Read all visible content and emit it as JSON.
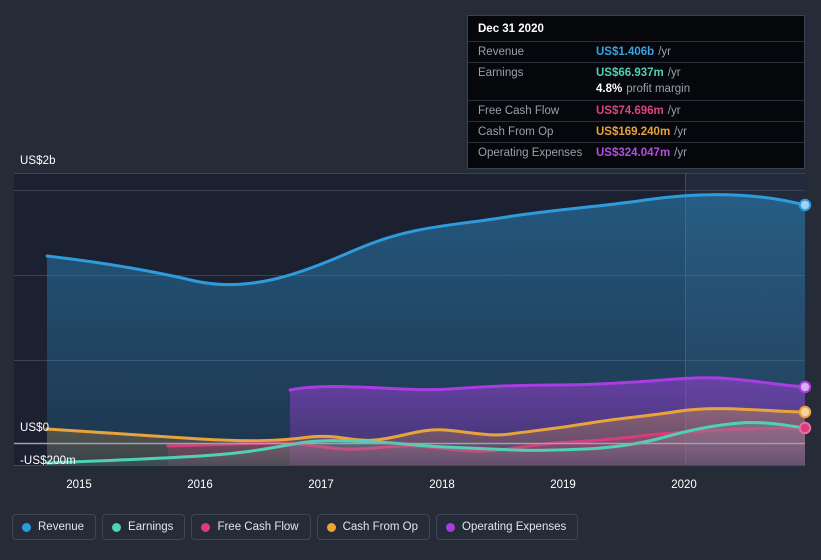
{
  "tooltip": {
    "date": "Dec 31 2020",
    "rows": [
      {
        "label": "Revenue",
        "value": "US$1.406b",
        "unit": "/yr",
        "color": "#3aa3e3"
      },
      {
        "label": "Earnings",
        "value": "US$66.937m",
        "unit": "/yr",
        "color": "#4fd1b3"
      },
      {
        "label": "",
        "value": "4.8%",
        "unit": "profit margin",
        "color": "#ffffff",
        "sub": true
      },
      {
        "label": "Free Cash Flow",
        "value": "US$74.696m",
        "unit": "/yr",
        "color": "#e0437f"
      },
      {
        "label": "Cash From Op",
        "value": "US$169.240m",
        "unit": "/yr",
        "color": "#e8a33d"
      },
      {
        "label": "Operating Expenses",
        "value": "US$324.047m",
        "unit": "/yr",
        "color": "#b44ee0"
      }
    ]
  },
  "legend": {
    "items": [
      {
        "label": "Revenue",
        "color": "#2e9bdd"
      },
      {
        "label": "Earnings",
        "color": "#4fd1b3"
      },
      {
        "label": "Free Cash Flow",
        "color": "#d63d79"
      },
      {
        "label": "Cash From Op",
        "color": "#e8a33d"
      },
      {
        "label": "Operating Expenses",
        "color": "#a83de0"
      }
    ]
  },
  "axes": {
    "y_top_label": "US$2b",
    "y_zero_label": "US$0",
    "y_neg_label": "-US$200m",
    "x_labels": [
      "2015",
      "2016",
      "2017",
      "2018",
      "2019",
      "2020"
    ]
  },
  "chart_data": {
    "type": "area",
    "title": "",
    "subtitle": "",
    "xlabel": "",
    "ylabel": "",
    "grid": true,
    "legend_position": "bottom",
    "xlim": [
      "2014-09",
      "2020-12"
    ],
    "ylim": [
      -200000000,
      2470000000
    ],
    "y_ticks": [
      2000000000,
      0,
      -200000000
    ],
    "y_tick_labels": [
      "US$2b",
      "US$0",
      "-US$200m"
    ],
    "x_ticks": [
      "2015",
      "2016",
      "2017",
      "2018",
      "2019",
      "2020"
    ],
    "units": "USD",
    "highlight_date": "Dec 31 2020",
    "series": [
      {
        "name": "Revenue",
        "color": "#2e9bdd",
        "x": [
          "2014-09",
          "2015-03",
          "2015-09",
          "2016-03",
          "2016-09",
          "2017-03",
          "2017-09",
          "2018-03",
          "2018-09",
          "2019-03",
          "2019-09",
          "2020-03",
          "2020-06",
          "2020-09",
          "2020-12"
        ],
        "values": [
          1100000000,
          1075000000,
          1035000000,
          1030000000,
          1085000000,
          1190000000,
          1255000000,
          1320000000,
          1370000000,
          1430000000,
          1480000000,
          1560000000,
          1555000000,
          1500000000,
          1406000000
        ],
        "last_value": 1406000000,
        "last_value_label": "US$1.406b"
      },
      {
        "name": "Earnings",
        "color": "#4fd1b3",
        "x": [
          "2014-09",
          "2015-03",
          "2015-09",
          "2016-03",
          "2016-09",
          "2017-03",
          "2017-09",
          "2018-03",
          "2018-09",
          "2019-03",
          "2019-09",
          "2020-03",
          "2020-06",
          "2020-09",
          "2020-12"
        ],
        "values": [
          -195000000,
          -180000000,
          -165000000,
          -125000000,
          -60000000,
          -20000000,
          -28000000,
          -35000000,
          -30000000,
          -25000000,
          -5000000,
          25000000,
          55000000,
          80000000,
          66937000
        ],
        "last_value": 66937000,
        "last_value_label": "US$66.937m"
      },
      {
        "name": "Free Cash Flow",
        "color": "#d63d79",
        "x": [
          "2015-06",
          "2015-12",
          "2016-06",
          "2016-12",
          "2017-06",
          "2017-12",
          "2018-06",
          "2018-12",
          "2019-06",
          "2019-12",
          "2020-06",
          "2020-12"
        ],
        "values": [
          -28000000,
          -25000000,
          -22000000,
          -20000000,
          -55000000,
          -32000000,
          -15000000,
          -35000000,
          -10000000,
          5000000,
          40000000,
          74696000
        ],
        "last_value": 74696000,
        "last_value_label": "US$74.696m"
      },
      {
        "name": "Cash From Op",
        "color": "#e8a33d",
        "x": [
          "2014-09",
          "2015-03",
          "2015-09",
          "2016-03",
          "2016-09",
          "2017-03",
          "2017-09",
          "2018-03",
          "2018-09",
          "2019-03",
          "2019-09",
          "2020-03",
          "2020-09",
          "2020-12"
        ],
        "values": [
          20000000,
          12000000,
          5000000,
          0,
          -5000000,
          15000000,
          -20000000,
          30000000,
          20000000,
          60000000,
          95000000,
          120000000,
          160000000,
          169240000
        ],
        "last_value": 169240000,
        "last_value_label": "US$169.240m"
      },
      {
        "name": "Operating Expenses",
        "color": "#a83de0",
        "x": [
          "2016-09",
          "2017-03",
          "2017-09",
          "2018-03",
          "2018-09",
          "2019-03",
          "2019-09",
          "2020-03",
          "2020-09",
          "2020-12"
        ],
        "values": [
          315000000,
          320000000,
          300000000,
          315000000,
          320000000,
          315000000,
          325000000,
          345000000,
          335000000,
          324047000
        ],
        "last_value": 324047000,
        "last_value_label": "US$324.047m"
      }
    ]
  }
}
